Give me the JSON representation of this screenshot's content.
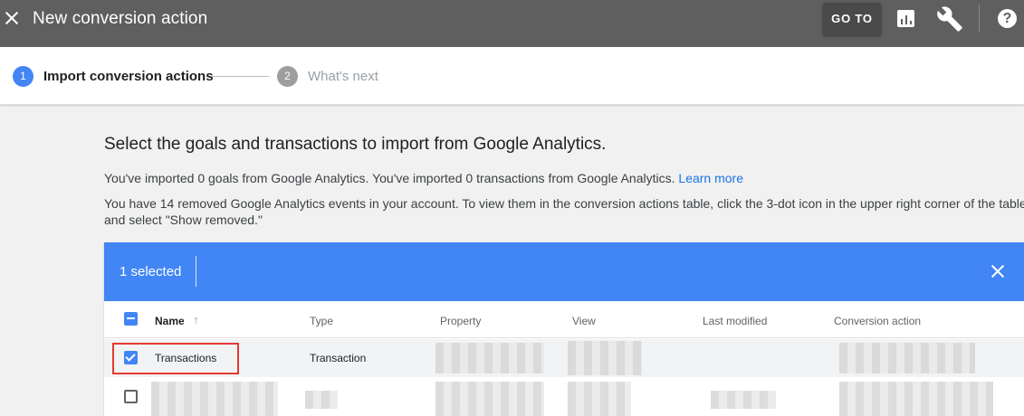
{
  "topbar": {
    "title": "New conversion action",
    "goto_label": "GO TO",
    "help_glyph": "?",
    "icons": [
      "close-icon",
      "reports-icon",
      "wrench-icon",
      "help-icon"
    ],
    "background": "#5f5f5f"
  },
  "stepper": {
    "steps": [
      {
        "number": "1",
        "label": "Import conversion actions",
        "active": true
      },
      {
        "number": "2",
        "label": "What's next",
        "active": false
      }
    ]
  },
  "main": {
    "title": "Select the goals and transactions to import from Google Analytics.",
    "import_summary": "You've imported 0 goals from Google Analytics. You've imported 0 transactions from Google Analytics.",
    "learn_more": "Learn more",
    "removed_notice": "You have 14 removed Google Analytics events in your account. To view them in the conversion actions table, click the 3-dot icon in the upper right corner of the table and select \"Show removed.\""
  },
  "table": {
    "selection_text": "1 selected",
    "accent": "#4285f4",
    "columns": {
      "name": "Name",
      "type": "Type",
      "property": "Property",
      "view": "View",
      "last_modified": "Last modified",
      "conversion_action": "Conversion action"
    },
    "rows": [
      {
        "name": "Transactions",
        "type": "Transaction",
        "checked": true
      },
      {
        "name": "",
        "type": "",
        "checked": false
      }
    ]
  }
}
